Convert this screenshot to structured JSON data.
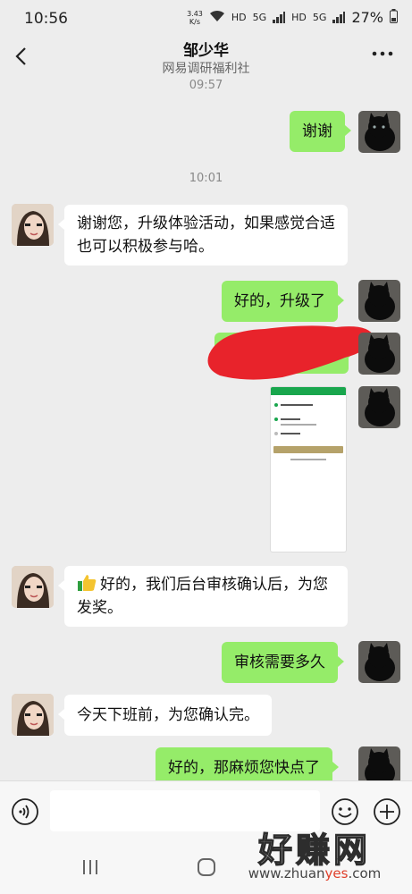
{
  "status_bar": {
    "time": "10:56",
    "net_speed_value": "3.43",
    "net_speed_unit": "K/s",
    "hd1": "HD",
    "sig1": "5G",
    "hd2": "HD",
    "sig2": "5G",
    "battery": "27%"
  },
  "header": {
    "title": "邹少华",
    "subtitle": "网易调研福利社"
  },
  "messages": [
    {
      "side": "right",
      "time_above": "09:57",
      "text": "谢谢"
    },
    {
      "side": "left",
      "time_above": "10:01",
      "text": "谢谢您，升级体验活动，如果感觉合适也可以积极参与哈。"
    },
    {
      "side": "right",
      "text": "好的，升级了"
    },
    {
      "side": "right",
      "type": "redacted"
    },
    {
      "side": "right",
      "type": "image"
    },
    {
      "side": "left",
      "emoji": "thumbs-up",
      "text": "好的，我们后台审核确认后，为您发奖。"
    },
    {
      "side": "right",
      "text": "审核需要多久"
    },
    {
      "side": "left",
      "text": "今天下班前，为您确认完。"
    },
    {
      "side": "right",
      "text": "好的，那麻烦您快点了"
    }
  ],
  "input": {
    "value": "",
    "placeholder": ""
  },
  "icons": {
    "back": "back-arrow-icon",
    "more": "more-dots-icon",
    "voice": "voice-icon",
    "emoji": "emoji-icon",
    "plus": "plus-icon",
    "nav_recent": "recent-apps-icon",
    "nav_home": "home-icon"
  },
  "colors": {
    "chat_bg": "#ededed",
    "bubble_self": "#95ec69",
    "bubble_other": "#ffffff",
    "redaction": "#e8232b"
  },
  "watermark": {
    "title": "好赚网",
    "url_prefix": "www.zhuan",
    "url_accent": "yes",
    "url_suffix": ".com"
  }
}
